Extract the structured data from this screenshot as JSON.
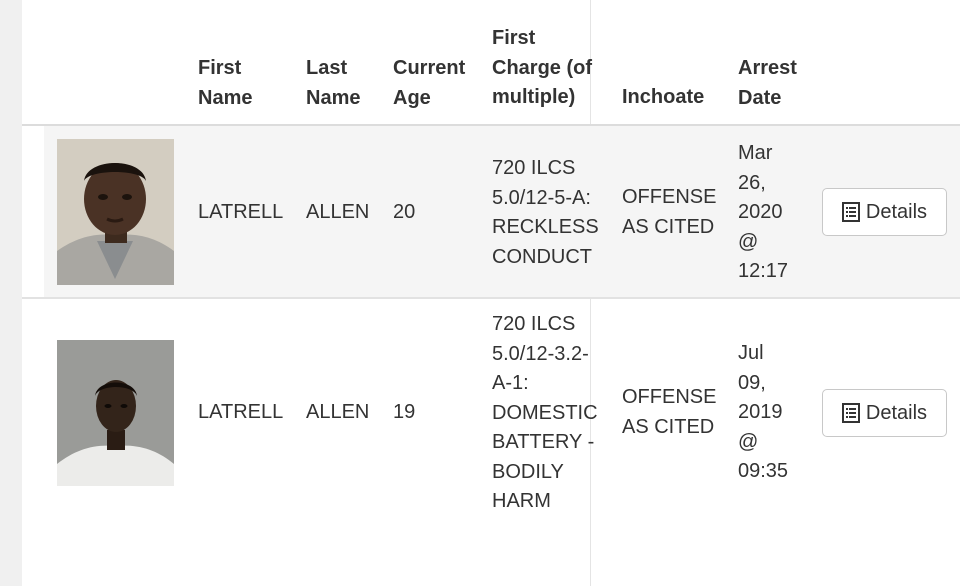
{
  "table": {
    "headers": {
      "first_name": [
        "First",
        "Name"
      ],
      "last_name": [
        "Last",
        "Name"
      ],
      "current_age": [
        "Current",
        "Age"
      ],
      "first_charge": [
        "First",
        "Charge (of",
        "multiple)"
      ],
      "inchoate": [
        "Inchoate"
      ],
      "arrest_date": [
        "Arrest",
        "Date"
      ]
    },
    "rows": [
      {
        "first_name": "LATRELL",
        "last_name": "ALLEN",
        "age": "20",
        "charge_lines": [
          "720 ILCS",
          "5.0/12-5-A:",
          "RECKLESS",
          "CONDUCT"
        ],
        "inchoate_lines": [
          "OFFENSE",
          "AS CITED"
        ],
        "date_lines": [
          "Mar",
          "26,",
          "2020",
          "@",
          "12:17"
        ],
        "details_label": "Details"
      },
      {
        "first_name": "LATRELL",
        "last_name": "ALLEN",
        "age": "19",
        "charge_lines": [
          "720 ILCS",
          "5.0/12-3.2-",
          "A-1:",
          "DOMESTIC",
          "BATTERY -",
          "BODILY",
          "HARM"
        ],
        "inchoate_lines": [
          "OFFENSE",
          "AS CITED"
        ],
        "date_lines": [
          "Jul",
          "09,",
          "2019",
          "@",
          "09:35"
        ],
        "details_label": "Details"
      }
    ]
  },
  "icons": {
    "details_icon": "list-document-icon",
    "photo": "person-photo"
  },
  "colors": {
    "striped_row": "#f5f5f5",
    "border": "#dddddd",
    "text": "#333333"
  }
}
